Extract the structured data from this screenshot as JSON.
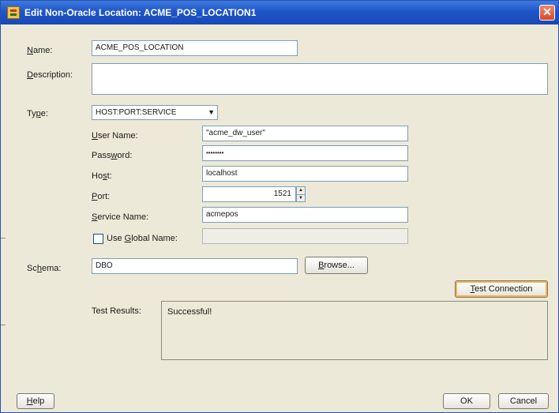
{
  "window": {
    "title": "Edit Non-Oracle Location: ACME_POS_LOCATION1",
    "close_glyph": "✕"
  },
  "form": {
    "name_label_first": "N",
    "name_label_rest": "ame:",
    "name_value": "ACME_POS_LOCATION",
    "description_label_first": "D",
    "description_label_rest": "escription:",
    "description_value": "",
    "type_label_first": "Ty",
    "type_label_u": "p",
    "type_label_rest": "e:",
    "type_value": "HOST:PORT:SERVICE",
    "type_arrow": "▼",
    "username_label_first": "U",
    "username_label_rest": "ser Name:",
    "username_value": "\"acme_dw_user\"",
    "password_label_first": "Pass",
    "password_label_u": "w",
    "password_label_rest": "ord:",
    "password_value": "••••••••",
    "host_label_first": "Ho",
    "host_label_u": "s",
    "host_label_rest": "t:",
    "host_value": "localhost",
    "port_label_first": "P",
    "port_label_rest": "ort:",
    "port_value": "1521",
    "service_label_first": "S",
    "service_label_rest": "ervice Name:",
    "service_value": "acmepos",
    "global_name_label_pre": "Use ",
    "global_name_label_u": "G",
    "global_name_label_rest": "lobal Name:",
    "global_name_value": "",
    "schema_label_first": "Sc",
    "schema_label_u": "h",
    "schema_label_rest": "ema:",
    "schema_value": "DBO",
    "browse_label_first": "B",
    "browse_label_rest": "rowse...",
    "test_connection_first": "T",
    "test_connection_rest": "est Connection",
    "test_results_label": "Test Results:",
    "test_results_value": "Successful!"
  },
  "footer": {
    "help_first": "H",
    "help_rest": "elp",
    "ok_label": "OK",
    "cancel_label": "Cancel"
  }
}
